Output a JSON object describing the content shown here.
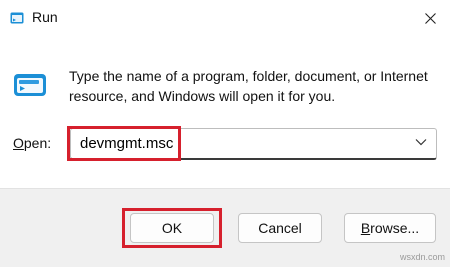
{
  "window": {
    "title": "Run"
  },
  "description": "Type the name of a program, folder, document, or Internet resource, and Windows will open it for you.",
  "open_field": {
    "label_underlined": "O",
    "label_rest": "pen:",
    "value": "devmgmt.msc"
  },
  "buttons": {
    "ok": "OK",
    "cancel": "Cancel",
    "browse_underlined": "B",
    "browse_rest": "rowse..."
  },
  "watermark": "wsxdn.com",
  "colors": {
    "highlight": "#d6202d",
    "footer_bg": "#f0f0f0",
    "icon_blue": "#1b8fd6"
  },
  "icons": [
    "run-app-icon",
    "close-icon",
    "run-large-icon",
    "chevron-down-icon"
  ]
}
